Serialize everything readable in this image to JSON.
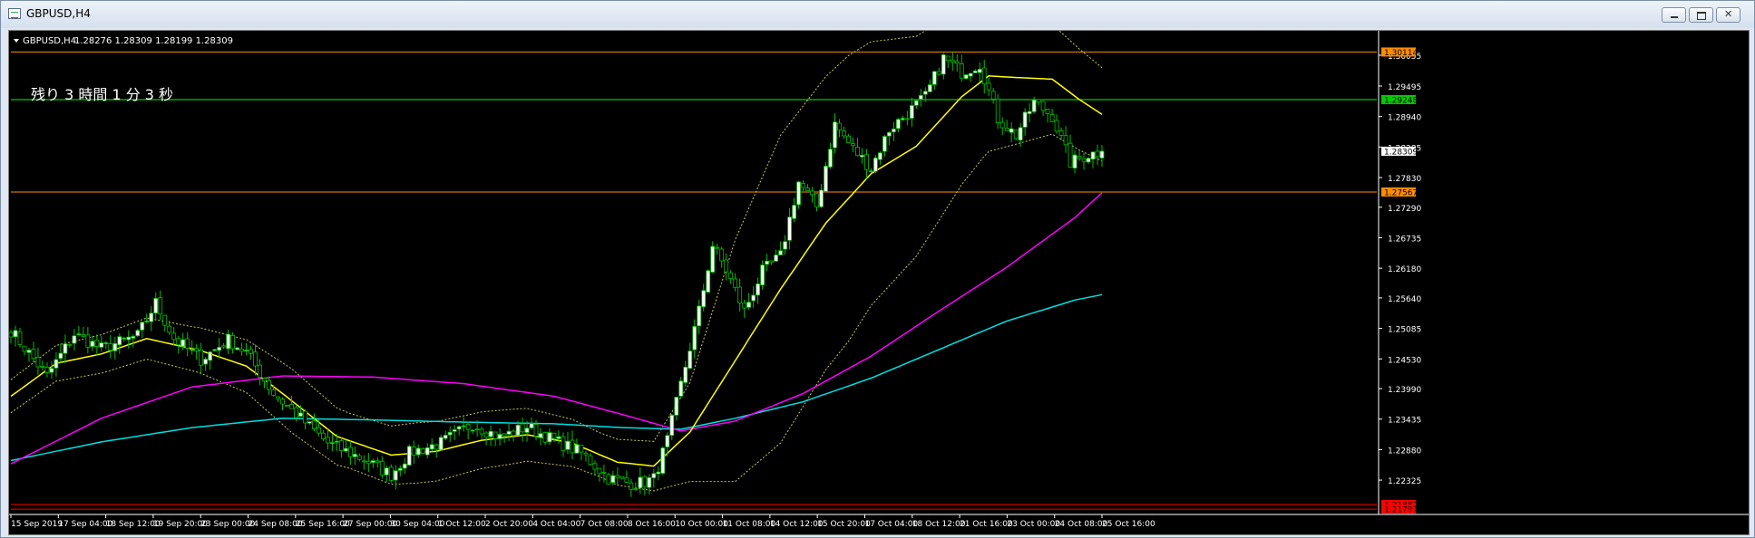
{
  "window": {
    "title": "GBPUSD,H4"
  },
  "info_line": {
    "symbol": "GBPUSD,H4",
    "ohlc": "1.28276 1.28309 1.28199 1.28309"
  },
  "countdown": {
    "label": "残り 3 時間 1 分 3 秒"
  },
  "colors": {
    "background": "#000000",
    "bull_candle": "#ffffff",
    "bear_candle": "#000000",
    "candle_outline": "#00c000",
    "ma20": "#ffff00",
    "ma100": "#ff00ff",
    "ma200": "#00e0e0",
    "bands": "#c8c85a",
    "resistance_line": "#ff8c00",
    "support_line": "#ff0000",
    "green_line": "#00ff00"
  },
  "price_scale": {
    "ticks": [
      "1.30055",
      "1.29495",
      "1.28940",
      "1.28385",
      "1.27830",
      "1.27290",
      "1.26735",
      "1.26180",
      "1.25640",
      "1.25085",
      "1.24530",
      "1.23990",
      "1.23435",
      "1.22880",
      "1.22325"
    ],
    "tags": [
      {
        "value": "1.30114",
        "color": "#ff8c00"
      },
      {
        "value": "1.29248",
        "color": "#00cc00"
      },
      {
        "value": "1.28309",
        "color": "#ffffff"
      },
      {
        "value": "1.27567",
        "color": "#ff8c00"
      },
      {
        "value": "1.21882",
        "color": "#ff0000"
      },
      {
        "value": "1.21797",
        "color": "#ff0000"
      }
    ]
  },
  "time_scale": {
    "labels": [
      "15 Sep 2019",
      "17 Sep 04:00",
      "18 Sep 12:00",
      "19 Sep 20:00",
      "23 Sep 00:00",
      "24 Sep 08:00",
      "25 Sep 16:00",
      "27 Sep 00:00",
      "30 Sep 04:00",
      "1 Oct 12:00",
      "2 Oct 20:00",
      "4 Oct 04:00",
      "7 Oct 08:00",
      "8 Oct 16:00",
      "10 Oct 00:00",
      "11 Oct 08:00",
      "14 Oct 12:00",
      "15 Oct 20:00",
      "17 Oct 04:00",
      "18 Oct 12:00",
      "21 Oct 16:00",
      "23 Oct 00:00",
      "24 Oct 08:00",
      "25 Oct 16:00"
    ]
  },
  "horizontal_lines": [
    {
      "price": 1.30114,
      "color": "#ff8c00"
    },
    {
      "price": 1.29248,
      "color": "#00ff00"
    },
    {
      "price": 1.27567,
      "color": "#ff8c00"
    },
    {
      "price": 1.21882,
      "color": "#ff0000"
    },
    {
      "price": 1.21797,
      "color": "#ff0000"
    }
  ],
  "chart_data": {
    "type": "candlestick",
    "symbol": "GBPUSD",
    "timeframe": "H4",
    "ylim": [
      1.217,
      1.305
    ],
    "close_anchors": [
      [
        0,
        1.2505
      ],
      [
        8,
        1.2422
      ],
      [
        14,
        1.2498
      ],
      [
        20,
        1.2472
      ],
      [
        28,
        1.2495
      ],
      [
        32,
        1.2555
      ],
      [
        36,
        1.249
      ],
      [
        42,
        1.2452
      ],
      [
        48,
        1.2488
      ],
      [
        52,
        1.2465
      ],
      [
        58,
        1.239
      ],
      [
        64,
        1.2345
      ],
      [
        70,
        1.23
      ],
      [
        78,
        1.227
      ],
      [
        84,
        1.2242
      ],
      [
        88,
        1.2282
      ],
      [
        95,
        1.23
      ],
      [
        102,
        1.2335
      ],
      [
        108,
        1.231
      ],
      [
        114,
        1.233
      ],
      [
        120,
        1.2305
      ],
      [
        126,
        1.2282
      ],
      [
        132,
        1.2236
      ],
      [
        138,
        1.2225
      ],
      [
        142,
        1.2235
      ],
      [
        145,
        1.2305
      ],
      [
        149,
        1.244
      ],
      [
        152,
        1.254
      ],
      [
        155,
        1.266
      ],
      [
        158,
        1.2615
      ],
      [
        162,
        1.254
      ],
      [
        166,
        1.2612
      ],
      [
        170,
        1.264
      ],
      [
        174,
        1.2775
      ],
      [
        178,
        1.273
      ],
      [
        182,
        1.288
      ],
      [
        186,
        1.2835
      ],
      [
        190,
        1.28
      ],
      [
        194,
        1.287
      ],
      [
        198,
        1.29
      ],
      [
        202,
        1.293
      ],
      [
        206,
        1.3
      ],
      [
        210,
        1.2975
      ],
      [
        214,
        1.299
      ],
      [
        218,
        1.289
      ],
      [
        222,
        1.286
      ],
      [
        226,
        1.292
      ],
      [
        230,
        1.2895
      ],
      [
        234,
        1.281
      ],
      [
        238,
        1.2825
      ],
      [
        241,
        1.2831
      ]
    ],
    "ma20_anchors": [
      [
        0,
        1.2385
      ],
      [
        10,
        1.2445
      ],
      [
        20,
        1.2462
      ],
      [
        30,
        1.249
      ],
      [
        42,
        1.2468
      ],
      [
        52,
        1.244
      ],
      [
        60,
        1.239
      ],
      [
        72,
        1.2312
      ],
      [
        84,
        1.2278
      ],
      [
        94,
        1.2285
      ],
      [
        104,
        1.2305
      ],
      [
        114,
        1.2315
      ],
      [
        124,
        1.23
      ],
      [
        134,
        1.2265
      ],
      [
        142,
        1.2258
      ],
      [
        150,
        1.232
      ],
      [
        160,
        1.245
      ],
      [
        170,
        1.258
      ],
      [
        180,
        1.27
      ],
      [
        190,
        1.279
      ],
      [
        200,
        1.284
      ],
      [
        210,
        1.293
      ],
      [
        216,
        1.2968
      ],
      [
        222,
        1.2965
      ],
      [
        230,
        1.2962
      ],
      [
        236,
        1.2925
      ],
      [
        241,
        1.2898
      ]
    ],
    "ma100_anchors": [
      [
        0,
        1.2262
      ],
      [
        20,
        1.2345
      ],
      [
        40,
        1.2402
      ],
      [
        60,
        1.2422
      ],
      [
        80,
        1.242
      ],
      [
        100,
        1.2408
      ],
      [
        120,
        1.2385
      ],
      [
        135,
        1.2352
      ],
      [
        148,
        1.2322
      ],
      [
        160,
        1.234
      ],
      [
        175,
        1.239
      ],
      [
        190,
        1.2458
      ],
      [
        205,
        1.254
      ],
      [
        220,
        1.262
      ],
      [
        235,
        1.271
      ],
      [
        241,
        1.2755
      ]
    ],
    "ma200_anchors": [
      [
        0,
        1.2268
      ],
      [
        20,
        1.2302
      ],
      [
        40,
        1.2328
      ],
      [
        60,
        1.2345
      ],
      [
        80,
        1.2342
      ],
      [
        100,
        1.2338
      ],
      [
        120,
        1.2335
      ],
      [
        135,
        1.2328
      ],
      [
        148,
        1.2325
      ],
      [
        160,
        1.2345
      ],
      [
        175,
        1.2375
      ],
      [
        190,
        1.2418
      ],
      [
        205,
        1.247
      ],
      [
        220,
        1.2522
      ],
      [
        235,
        1.256
      ],
      [
        241,
        1.257
      ]
    ],
    "bands_width_anchors": [
      [
        0,
        0.003
      ],
      [
        20,
        0.0035
      ],
      [
        40,
        0.004
      ],
      [
        52,
        0.0048
      ],
      [
        62,
        0.0058
      ],
      [
        75,
        0.005
      ],
      [
        90,
        0.0055
      ],
      [
        110,
        0.005
      ],
      [
        130,
        0.004
      ],
      [
        142,
        0.0045
      ],
      [
        150,
        0.009
      ],
      [
        160,
        0.022
      ],
      [
        170,
        0.028
      ],
      [
        185,
        0.026
      ],
      [
        200,
        0.02
      ],
      [
        215,
        0.014
      ],
      [
        230,
        0.01
      ],
      [
        241,
        0.0085
      ]
    ]
  }
}
